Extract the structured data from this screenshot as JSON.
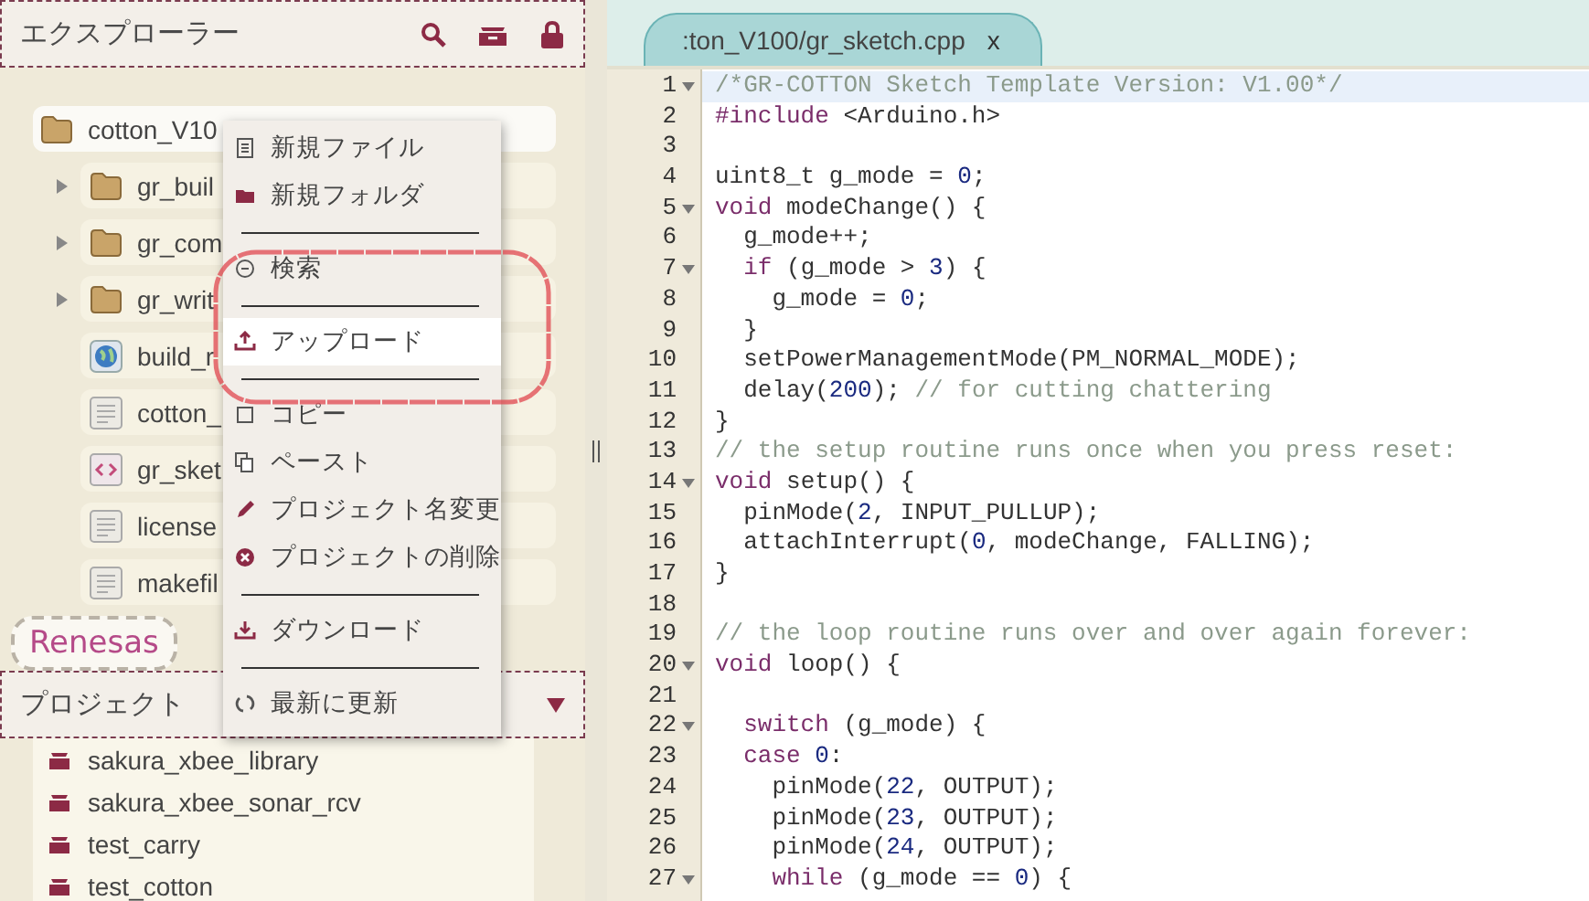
{
  "explorer": {
    "title": "エクスプローラー",
    "tree": {
      "label": "cotton_V10",
      "kind": "folder",
      "children": [
        {
          "label": "gr_buil",
          "kind": "folder",
          "expanded": false
        },
        {
          "label": "gr_com",
          "kind": "folder",
          "expanded": false
        },
        {
          "label": "gr_writ",
          "kind": "folder",
          "expanded": false
        },
        {
          "label": "build_r",
          "kind": "web"
        },
        {
          "label": "cotton_",
          "kind": "text"
        },
        {
          "label": "gr_sket",
          "kind": "code"
        },
        {
          "label": "license",
          "kind": "text"
        },
        {
          "label": "makefil",
          "kind": "text"
        }
      ]
    }
  },
  "logo": {
    "text": "Renesas"
  },
  "projects": {
    "title": "プロジェクト",
    "items": [
      "sakura_xbee_library",
      "sakura_xbee_sonar_rcv",
      "test_carry",
      "test_cotton"
    ]
  },
  "context_menu": [
    {
      "kind": "item",
      "label": "新規ファイル",
      "selected": false
    },
    {
      "kind": "item",
      "label": "新規フォルダ",
      "selected": false
    },
    {
      "kind": "separator"
    },
    {
      "kind": "item",
      "label": "検索",
      "selected": false
    },
    {
      "kind": "separator"
    },
    {
      "kind": "item",
      "label": "アップロード",
      "selected": true
    },
    {
      "kind": "separator"
    },
    {
      "kind": "item",
      "label": "コピー",
      "selected": false
    },
    {
      "kind": "item",
      "label": "ペースト",
      "selected": false
    },
    {
      "kind": "item",
      "label": "プロジェクト名変更",
      "selected": false
    },
    {
      "kind": "item",
      "label": "プロジェクトの削除",
      "selected": false
    },
    {
      "kind": "separator"
    },
    {
      "kind": "item",
      "label": "ダウンロード",
      "selected": false
    },
    {
      "kind": "separator"
    },
    {
      "kind": "item",
      "label": "最新に更新",
      "selected": false
    }
  ],
  "editor": {
    "tab": {
      "label": ":ton_V100/gr_sketch.cpp",
      "close": "x"
    },
    "lines": [
      {
        "number": "1",
        "fold": true,
        "active": true,
        "tokens": [
          {
            "kind": "comment",
            "text": "/*GR-COTTON Sketch Template Version: V1.00*/"
          }
        ]
      },
      {
        "number": "2",
        "fold": false,
        "active": false,
        "tokens": [
          {
            "kind": "keyword",
            "text": "#include"
          },
          {
            "kind": "plain",
            "text": " <Arduino.h>"
          }
        ]
      },
      {
        "number": "3",
        "fold": false,
        "active": false
      },
      {
        "number": "4",
        "fold": false,
        "active": false,
        "tokens": [
          {
            "kind": "plain",
            "text": "uint8_t g_mode = "
          },
          {
            "kind": "number",
            "text": "0"
          },
          {
            "kind": "plain",
            "text": ";"
          }
        ]
      },
      {
        "number": "5",
        "fold": true,
        "active": false,
        "tokens": [
          {
            "kind": "keyword",
            "text": "void"
          },
          {
            "kind": "plain",
            "text": " modeChange() {"
          }
        ]
      },
      {
        "number": "6",
        "fold": false,
        "active": false,
        "tokens": [
          {
            "kind": "plain",
            "text": "  g_mode++;"
          }
        ]
      },
      {
        "number": "7",
        "fold": true,
        "active": false,
        "tokens": [
          {
            "kind": "keyword",
            "text": "  if"
          },
          {
            "kind": "plain",
            "text": " (g_mode > "
          },
          {
            "kind": "number",
            "text": "3"
          },
          {
            "kind": "plain",
            "text": ") {"
          }
        ]
      },
      {
        "number": "8",
        "fold": false,
        "active": false,
        "tokens": [
          {
            "kind": "plain",
            "text": "    g_mode = "
          },
          {
            "kind": "number",
            "text": "0"
          },
          {
            "kind": "plain",
            "text": ";"
          }
        ]
      },
      {
        "number": "9",
        "fold": false,
        "active": false,
        "tokens": [
          {
            "kind": "plain",
            "text": "  }"
          }
        ]
      },
      {
        "number": "10",
        "fold": false,
        "active": false,
        "tokens": [
          {
            "kind": "plain",
            "text": "  setPowerManagementMode(PM_NORMAL_MODE);"
          }
        ]
      },
      {
        "number": "11",
        "fold": false,
        "active": false,
        "tokens": [
          {
            "kind": "plain",
            "text": "  delay("
          },
          {
            "kind": "number",
            "text": "200"
          },
          {
            "kind": "plain",
            "text": "); "
          },
          {
            "kind": "comment",
            "text": "// for cutting chattering"
          }
        ]
      },
      {
        "number": "12",
        "fold": false,
        "active": false,
        "tokens": [
          {
            "kind": "plain",
            "text": "}"
          }
        ]
      },
      {
        "number": "13",
        "fold": false,
        "active": false,
        "tokens": [
          {
            "kind": "comment",
            "text": "// the setup routine runs once when you press reset:"
          }
        ]
      },
      {
        "number": "14",
        "fold": true,
        "active": false,
        "tokens": [
          {
            "kind": "keyword",
            "text": "void"
          },
          {
            "kind": "plain",
            "text": " setup() {"
          }
        ]
      },
      {
        "number": "15",
        "fold": false,
        "active": false,
        "tokens": [
          {
            "kind": "plain",
            "text": "  pinMode("
          },
          {
            "kind": "number",
            "text": "2"
          },
          {
            "kind": "plain",
            "text": ", INPUT_PULLUP);"
          }
        ]
      },
      {
        "number": "16",
        "fold": false,
        "active": false,
        "tokens": [
          {
            "kind": "plain",
            "text": "  attachInterrupt("
          },
          {
            "kind": "number",
            "text": "0"
          },
          {
            "kind": "plain",
            "text": ", modeChange, FALLING);"
          }
        ]
      },
      {
        "number": "17",
        "fold": false,
        "active": false,
        "tokens": [
          {
            "kind": "plain",
            "text": "}"
          }
        ]
      },
      {
        "number": "18",
        "fold": false,
        "active": false
      },
      {
        "number": "19",
        "fold": false,
        "active": false,
        "tokens": [
          {
            "kind": "comment",
            "text": "// the loop routine runs over and over again forever:"
          }
        ]
      },
      {
        "number": "20",
        "fold": true,
        "active": false,
        "tokens": [
          {
            "kind": "keyword",
            "text": "void"
          },
          {
            "kind": "plain",
            "text": " loop() {"
          }
        ]
      },
      {
        "number": "21",
        "fold": false,
        "active": false
      },
      {
        "number": "22",
        "fold": true,
        "active": false,
        "tokens": [
          {
            "kind": "keyword",
            "text": "  switch"
          },
          {
            "kind": "plain",
            "text": " (g_mode) {"
          }
        ]
      },
      {
        "number": "23",
        "fold": false,
        "active": false,
        "tokens": [
          {
            "kind": "keyword",
            "text": "  case"
          },
          {
            "kind": "number",
            "text": " 0"
          },
          {
            "kind": "plain",
            "text": ":"
          }
        ]
      },
      {
        "number": "24",
        "fold": false,
        "active": false,
        "tokens": [
          {
            "kind": "plain",
            "text": "    pinMode("
          },
          {
            "kind": "number",
            "text": "22"
          },
          {
            "kind": "plain",
            "text": ", OUTPUT);"
          }
        ]
      },
      {
        "number": "25",
        "fold": false,
        "active": false,
        "tokens": [
          {
            "kind": "plain",
            "text": "    pinMode("
          },
          {
            "kind": "number",
            "text": "23"
          },
          {
            "kind": "plain",
            "text": ", OUTPUT);"
          }
        ]
      },
      {
        "number": "26",
        "fold": false,
        "active": false,
        "tokens": [
          {
            "kind": "plain",
            "text": "    pinMode("
          },
          {
            "kind": "number",
            "text": "24"
          },
          {
            "kind": "plain",
            "text": ", OUTPUT);"
          }
        ]
      },
      {
        "number": "27",
        "fold": true,
        "active": false,
        "tokens": [
          {
            "kind": "keyword",
            "text": "    while"
          },
          {
            "kind": "plain",
            "text": " (g_mode == "
          },
          {
            "kind": "number",
            "text": "0"
          },
          {
            "kind": "plain",
            "text": ") {"
          }
        ]
      }
    ]
  }
}
